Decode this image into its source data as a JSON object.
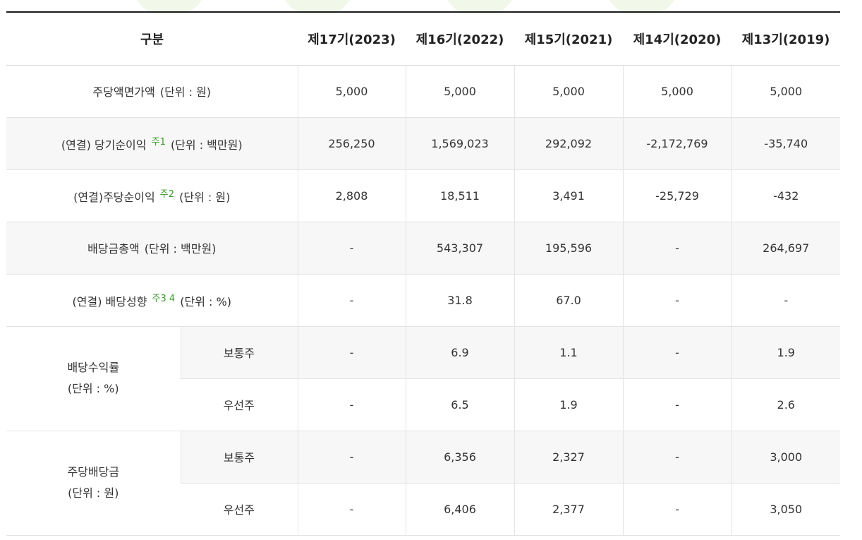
{
  "header": {
    "label": "구분",
    "years": [
      "제17기(2023)",
      "제16기(2022)",
      "제15기(2021)",
      "제14기(2020)",
      "제13기(2019)"
    ]
  },
  "rows": {
    "face_value": {
      "label": "주당액면가액",
      "unit": "(단위 : 원)",
      "values": [
        "5,000",
        "5,000",
        "5,000",
        "5,000",
        "5,000"
      ]
    },
    "net_income": {
      "prefix": "(연결) 당기순이익",
      "note": "주1",
      "unit": "(단위 : 백만원)",
      "values": [
        "256,250",
        "1,569,023",
        "292,092",
        "-2,172,769",
        "-35,740"
      ]
    },
    "eps": {
      "prefix": "(연결)주당순이익",
      "note": "주2",
      "unit": "(단위 : 원)",
      "values": [
        "2,808",
        "18,511",
        "3,491",
        "-25,729",
        "-432"
      ]
    },
    "total_dividend": {
      "label": "배당금총액",
      "unit": "(단위 : 백만원)",
      "values": [
        "-",
        "543,307",
        "195,596",
        "-",
        "264,697"
      ]
    },
    "payout_ratio": {
      "prefix": "(연결) 배당성향",
      "note": "주3 4",
      "unit": "(단위 : %)",
      "values": [
        "-",
        "31.8",
        "67.0",
        "-",
        "-"
      ]
    },
    "dividend_yield": {
      "label": "배당수익률",
      "unit": "(단위 : %)",
      "common": {
        "label": "보통주",
        "values": [
          "-",
          "6.9",
          "1.1",
          "-",
          "1.9"
        ]
      },
      "preferred": {
        "label": "우선주",
        "values": [
          "-",
          "6.5",
          "1.9",
          "-",
          "2.6"
        ]
      }
    },
    "dps": {
      "label": "주당배당금",
      "unit": "(단위 : 원)",
      "common": {
        "label": "보통주",
        "values": [
          "-",
          "6,356",
          "2,327",
          "-",
          "3,000"
        ]
      },
      "preferred": {
        "label": "우선주",
        "values": [
          "-",
          "6,406",
          "2,377",
          "-",
          "3,050"
        ]
      }
    }
  },
  "colors": {
    "note": "#3a9b2a",
    "shade": "#f7f7f7",
    "header_rule": "#1a1a1a",
    "decor": "#eef7e4"
  }
}
